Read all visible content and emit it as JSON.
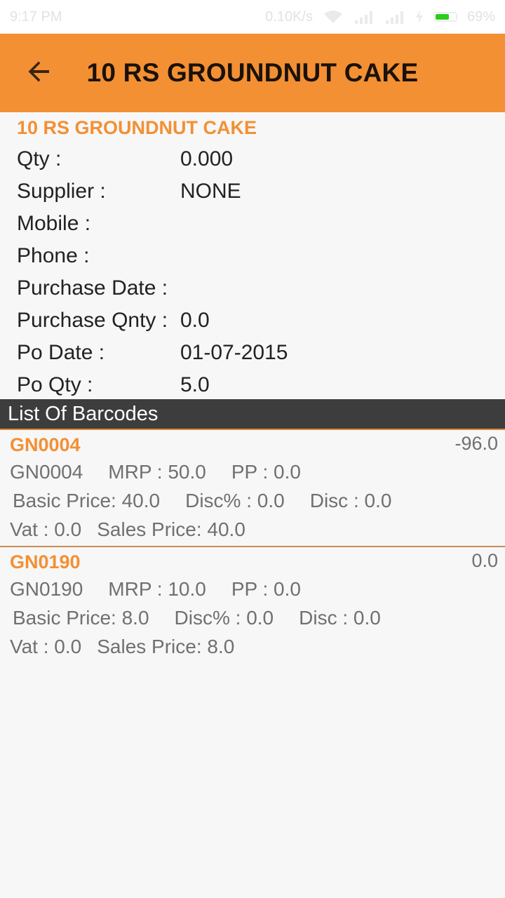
{
  "status_bar": {
    "time": "9:17 PM",
    "network_speed": "0.10K/s",
    "battery_percent": "69%",
    "battery_level": 0.69,
    "icons": [
      "wifi-icon",
      "signal-icon",
      "signal-icon",
      "charging-icon",
      "battery-icon"
    ]
  },
  "app_bar": {
    "back_icon": "arrow-back-icon",
    "title": "10 RS GROUNDNUT CAKE"
  },
  "details": {
    "product_name": "10 RS GROUNDNUT CAKE",
    "rows": [
      {
        "label": "Qty :",
        "value": "0.000"
      },
      {
        "label": "Supplier :",
        "value": "NONE"
      },
      {
        "label": "Mobile :",
        "value": ""
      },
      {
        "label": "Phone :",
        "value": ""
      },
      {
        "label": "Purchase Date :",
        "value": ""
      },
      {
        "label": "Purchase Qnty :",
        "value": "0.0"
      },
      {
        "label": "Po Date :",
        "value": "01-07-2015"
      },
      {
        "label": "Po Qty :",
        "value": "5.0"
      }
    ]
  },
  "barcodes_section": {
    "title": "List Of Barcodes",
    "items": [
      {
        "code": "GN0004",
        "qty": "-96.0",
        "code_text": "GN0004",
        "mrp": "MRP : 50.0",
        "pp": "PP : 0.0",
        "basic_price": "Basic Price: 40.0",
        "disc_pct": "Disc% : 0.0",
        "disc": "Disc : 0.0",
        "vat": "Vat : 0.0",
        "sales_price": "Sales Price: 40.0"
      },
      {
        "code": "GN0190",
        "qty": "0.0",
        "code_text": "GN0190",
        "mrp": "MRP : 10.0",
        "pp": "PP : 0.0",
        "basic_price": "Basic Price: 8.0",
        "disc_pct": "Disc% : 0.0",
        "disc": "Disc : 0.0",
        "vat": "Vat : 0.0",
        "sales_price": "Sales Price: 8.0"
      }
    ]
  },
  "colors": {
    "accent": "#f39034",
    "section_header": "#3d3d3d",
    "background": "#f7f7f7"
  }
}
